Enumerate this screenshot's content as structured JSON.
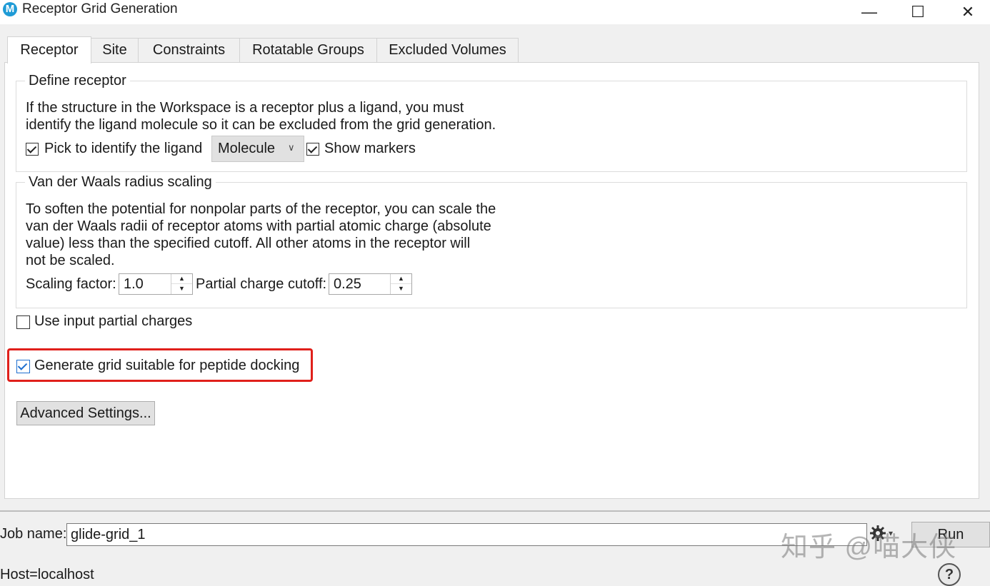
{
  "window": {
    "app_icon_letter": "M",
    "title": "Receptor Grid Generation",
    "minimize_glyph": "—",
    "maximize_glyph": "☐",
    "close_glyph": "✕"
  },
  "tabs": [
    {
      "label": "Receptor",
      "active": true
    },
    {
      "label": "Site",
      "active": false
    },
    {
      "label": "Constraints",
      "active": false
    },
    {
      "label": "Rotatable Groups",
      "active": false
    },
    {
      "label": "Excluded Volumes",
      "active": false
    }
  ],
  "define_receptor": {
    "title": "Define receptor",
    "description_line1": "If the structure in the Workspace is a receptor plus a ligand, you must",
    "description_line2": "identify the ligand molecule so it can be excluded from the grid generation.",
    "pick_ligand_label": "Pick to identify the ligand",
    "pick_ligand_checked": true,
    "pick_mode_value": "Molecule",
    "show_markers_label": "Show markers",
    "show_markers_checked": true
  },
  "vdw_scaling": {
    "title": "Van der Waals radius scaling",
    "description_line1": "To soften the potential for nonpolar parts of the receptor, you can scale the",
    "description_line2": "van der Waals radii of receptor atoms with partial atomic charge (absolute",
    "description_line3": "value) less than the specified cutoff.  All other atoms in the receptor will",
    "description_line4": "not be scaled.",
    "scaling_factor_label": "Scaling factor:",
    "scaling_factor_value": "1.0",
    "partial_charge_cutoff_label": "Partial charge cutoff:",
    "partial_charge_cutoff_value": "0.25"
  },
  "options": {
    "use_input_partial_charges_label": "Use input partial charges",
    "use_input_partial_charges_checked": false,
    "peptide_docking_label": "Generate grid suitable for peptide docking",
    "peptide_docking_checked": true,
    "advanced_settings_label": "Advanced Settings..."
  },
  "footer": {
    "job_name_label": "Job name:",
    "job_name_value": "glide-grid_1",
    "run_label": "Run",
    "host_text": "Host=localhost",
    "help_glyph": "?",
    "settings_icon": "gear-icon",
    "watermark_text": "知乎 @喵大侠"
  },
  "colors": {
    "highlight": "#e0201b",
    "checkbox_accent": "#1e6fd0",
    "app_icon": "#1f9bd6"
  }
}
